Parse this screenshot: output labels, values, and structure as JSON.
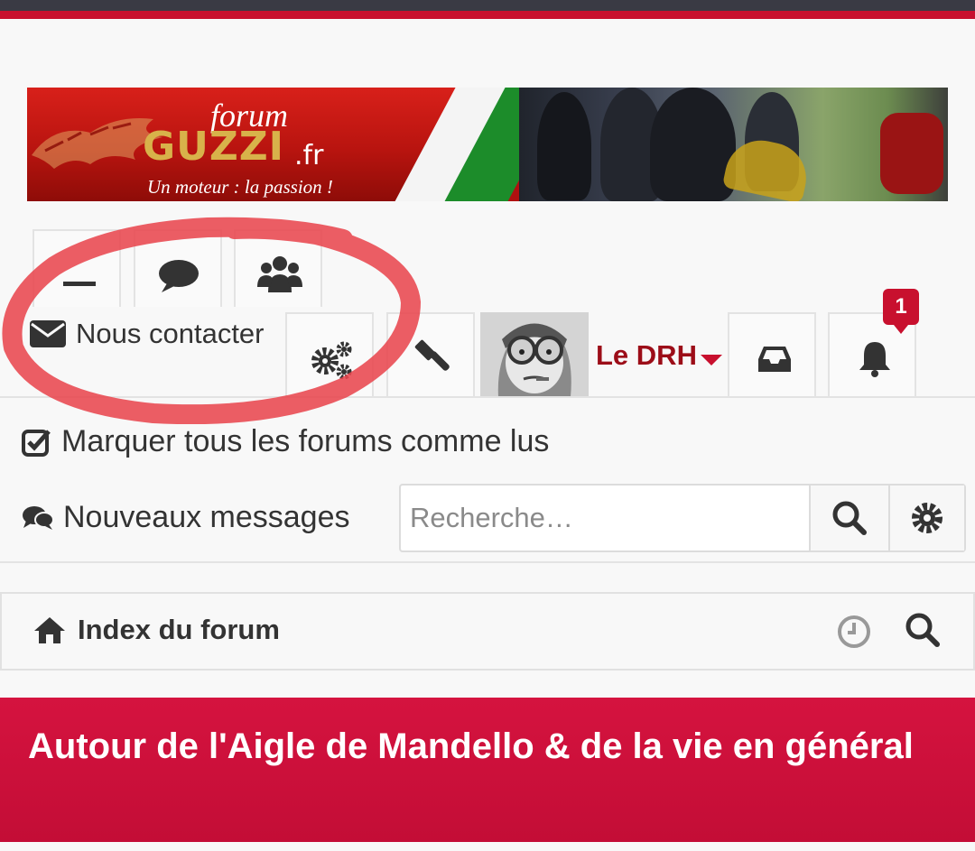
{
  "banner": {
    "logo_forum": "forum",
    "logo_guzzi": "GUZZI",
    "logo_fr": ".fr",
    "slogan": "Un moteur : la passion !"
  },
  "nav": {
    "contact_label": "Nous contacter",
    "user_name": "Le DRH",
    "notification_count": "1",
    "icons": [
      "faq-icon",
      "chat-icon",
      "members-icon",
      "mail-icon",
      "gears-icon",
      "gavel-icon",
      "inbox-icon",
      "bell-icon"
    ]
  },
  "quicklinks": {
    "mark_read": "Marquer tous les forums comme lus",
    "new_messages": "Nouveaux messages"
  },
  "search": {
    "placeholder": "Recherche…"
  },
  "breadcrumb": {
    "label": "Index du forum"
  },
  "section": {
    "title": "Autour de l'Aigle de Mandello & de la vie en général"
  },
  "colors": {
    "accent": "#c8102e",
    "username": "#9c0d18",
    "annotation": "#e8474f"
  }
}
